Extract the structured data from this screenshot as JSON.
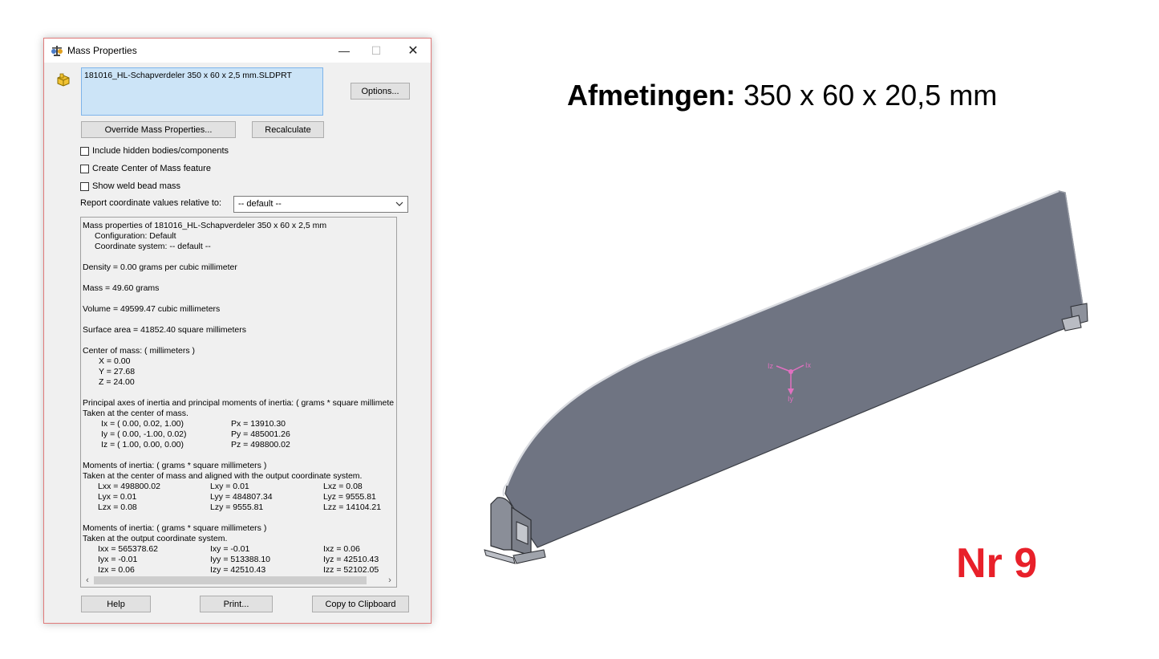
{
  "dialog": {
    "title": "Mass Properties",
    "window_controls": {
      "minimize": "—",
      "maximize": "☐",
      "close": "✕"
    },
    "selected_part": "181016_HL-Schapverdeler 350 x 60 x 2,5 mm.SLDPRT",
    "buttons": {
      "options": "Options...",
      "override": "Override Mass Properties...",
      "recalculate": "Recalculate",
      "help": "Help",
      "print": "Print...",
      "copy": "Copy to Clipboard"
    },
    "checkboxes": {
      "hidden_bodies": "Include hidden bodies/components",
      "center_of_mass": "Create Center of Mass feature",
      "weld_bead": "Show weld bead mass"
    },
    "coord_label": "Report coordinate values relative to:",
    "coord_value": "-- default --",
    "results": {
      "l01": "Mass properties of 181016_HL-Schapverdeler 350 x 60 x 2,5 mm",
      "l02": "Configuration: Default",
      "l03": "Coordinate system: -- default --",
      "l04": "Density = 0.00 grams per cubic millimeter",
      "l05": "Mass = 49.60 grams",
      "l06": "Volume = 49599.47 cubic millimeters",
      "l07": "Surface area = 41852.40  square millimeters",
      "l08": "Center of mass: ( millimeters )",
      "l09": "X = 0.00",
      "l10": "Y = 27.68",
      "l11": "Z = 24.00",
      "l12": "Principal axes of inertia and principal moments of inertia: ( grams *  square millimeters )",
      "l13": "Taken at the center of mass.",
      "p1a": "Ix = ( 0.00,  0.02,  1.00)",
      "p1b": "Px = 13910.30",
      "p2a": "Iy = ( 0.00, -1.00,  0.02)",
      "p2b": "Py = 485001.26",
      "p3a": "Iz = ( 1.00,  0.00,  0.00)",
      "p3b": "Pz = 498800.02",
      "l14": "Moments of inertia: ( grams *  square millimeters )",
      "l15": "Taken at the center of mass and aligned with the output coordinate system.",
      "m1a": "Lxx = 498800.02",
      "m1b": "Lxy = 0.01",
      "m1c": "Lxz = 0.08",
      "m2a": "Lyx = 0.01",
      "m2b": "Lyy = 484807.34",
      "m2c": "Lyz = 9555.81",
      "m3a": "Lzx = 0.08",
      "m3b": "Lzy = 9555.81",
      "m3c": "Lzz = 14104.21",
      "l16": "Moments of inertia: ( grams *  square millimeters )",
      "l17": "Taken at the output coordinate system.",
      "o1a": "Ixx = 565378.62",
      "o1b": "Ixy = -0.01",
      "o1c": "Ixz = 0.06",
      "o2a": "Iyx = -0.01",
      "o2b": "Iyy = 513388.10",
      "o2c": "Iyz = 42510.43",
      "o3a": "Izx = 0.06",
      "o3b": "Izy = 42510.43",
      "o3c": "Izz = 52102.05"
    }
  },
  "heading": {
    "label": "Afmetingen:",
    "value": "350 x 60 x 20,5 mm"
  },
  "number_label": "Nr 9",
  "axis_labels": {
    "ix": "Ix",
    "iy": "Iy",
    "iz": "Iz"
  },
  "colors": {
    "accent_red": "#e8202a",
    "selection": "#cce4f7",
    "model_face": "#6f7482"
  }
}
